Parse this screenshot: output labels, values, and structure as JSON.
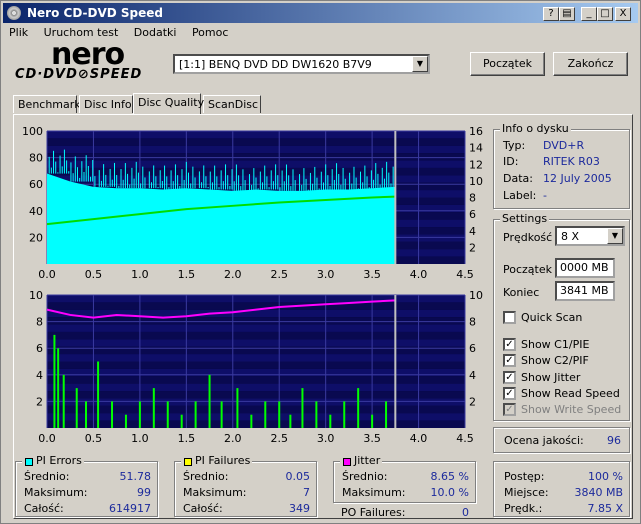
{
  "window": {
    "title": "Nero CD-DVD Speed",
    "help_label": "?",
    "minimize_label": "_",
    "maximize_label": "□",
    "close_label": "X"
  },
  "menu": [
    "Plik",
    "Uruchom test",
    "Dodatki",
    "Pomoc"
  ],
  "logo": {
    "brand": "nero",
    "product": "CD·DVD⊘SPEED"
  },
  "drive": {
    "selected": "[1:1]  BENQ DVD DD DW1620 B7V9"
  },
  "buttons": {
    "start": "Początek",
    "end": "Zakończ"
  },
  "tabs": [
    "Benchmark",
    "Disc Info",
    "Disc Quality",
    "ScanDisc"
  ],
  "active_tab": "Disc Quality",
  "disc_info": {
    "title": "Info o dysku",
    "rows": [
      {
        "label": "Typ:",
        "value": "DVD+R"
      },
      {
        "label": "ID:",
        "value": "RITEK R03"
      },
      {
        "label": "Data:",
        "value": "12 July 2005"
      },
      {
        "label": "Label:",
        "value": "-"
      }
    ]
  },
  "settings": {
    "title": "Settings",
    "speed_label": "Prędkość",
    "speed_value": "8 X",
    "start_label": "Początek",
    "start_value": "0000 MB",
    "end_label": "Koniec",
    "end_value": "3841 MB",
    "checks": [
      {
        "label": "Quick Scan",
        "checked": false,
        "enabled": true
      },
      {
        "label": "Show C1/PIE",
        "checked": true,
        "enabled": true
      },
      {
        "label": "Show C2/PIF",
        "checked": true,
        "enabled": true
      },
      {
        "label": "Show Jitter",
        "checked": true,
        "enabled": true
      },
      {
        "label": "Show Read Speed",
        "checked": true,
        "enabled": true
      },
      {
        "label": "Show Write Speed",
        "checked": true,
        "enabled": false
      }
    ]
  },
  "quality": {
    "label": "Ocena jakości:",
    "value": "96"
  },
  "pi_errors": {
    "title": "PI Errors",
    "color": "#00ffff",
    "rows": [
      {
        "label": "Średnio:",
        "value": "51.78"
      },
      {
        "label": "Maksimum:",
        "value": "99"
      },
      {
        "label": "Całość:",
        "value": "614917"
      }
    ]
  },
  "pi_failures": {
    "title": "PI Failures",
    "color": "#ffff00",
    "rows": [
      {
        "label": "Średnio:",
        "value": "0.05"
      },
      {
        "label": "Maksimum:",
        "value": "7"
      },
      {
        "label": "Całość:",
        "value": "349"
      }
    ]
  },
  "jitter": {
    "title": "Jitter",
    "color": "#ff00ff",
    "rows": [
      {
        "label": "Średnio:",
        "value": "8.65 %"
      },
      {
        "label": "Maksimum:",
        "value": "10.0 %"
      }
    ]
  },
  "po_failures": {
    "label": "PO Failures:",
    "value": "0"
  },
  "progress": {
    "rows": [
      {
        "label": "Postęp:",
        "value": "100 %"
      },
      {
        "label": "Miejsce:",
        "value": "3840 MB"
      },
      {
        "label": "Prędk.:",
        "value": "7.85 X"
      }
    ]
  },
  "chart_data": [
    {
      "type": "area",
      "panel": "PI errors / read speed",
      "x_ticks": [
        "0.0",
        "0.5",
        "1.0",
        "1.5",
        "2.0",
        "2.5",
        "3.0",
        "3.5",
        "4.0",
        "4.5"
      ],
      "y_left_ticks": [
        "100",
        "80",
        "60",
        "40",
        "20"
      ],
      "y_right_ticks": [
        "16",
        "14",
        "12",
        "10",
        "8",
        "6",
        "4",
        "2"
      ],
      "xlim": [
        0,
        4.5
      ],
      "ylim_left": [
        0,
        100
      ],
      "ylim_right": [
        0,
        16
      ],
      "scan_end_x": 3.75,
      "series": [
        {
          "color": "#00ffff",
          "values_x": [
            0,
            0.25,
            0.5,
            0.75,
            1.0,
            1.25,
            1.5,
            1.75,
            2.0,
            2.25,
            2.5,
            2.75,
            3.0,
            3.25,
            3.5,
            3.75
          ],
          "values_y": [
            68,
            62,
            58,
            57,
            57,
            56,
            57,
            56,
            55,
            56,
            55,
            55,
            56,
            56,
            57,
            58
          ]
        },
        {
          "color": "#00dd00",
          "axis": "right",
          "values_x": [
            0,
            0.5,
            1.0,
            1.5,
            2.0,
            2.5,
            3.0,
            3.5,
            3.75
          ],
          "values_y": [
            4.8,
            5.4,
            6.0,
            6.6,
            7.0,
            7.4,
            7.7,
            8.0,
            8.1
          ]
        }
      ]
    },
    {
      "type": "bar",
      "panel": "PI failures / jitter",
      "x_ticks": [
        "0.0",
        "0.5",
        "1.0",
        "1.5",
        "2.0",
        "2.5",
        "3.0",
        "3.5",
        "4.0",
        "4.5"
      ],
      "y_left_ticks": [
        "10",
        "8",
        "6",
        "4",
        "2"
      ],
      "y_right_ticks": [
        "10",
        "8",
        "6",
        "4",
        "2"
      ],
      "xlim": [
        0,
        4.5
      ],
      "ylim": [
        0,
        10
      ],
      "scan_end_x": 3.75,
      "failures": {
        "color": "#00ff00",
        "x": [
          0.08,
          0.12,
          0.18,
          0.32,
          0.42,
          0.55,
          0.7,
          0.85,
          1.0,
          1.15,
          1.3,
          1.45,
          1.6,
          1.75,
          1.88,
          2.05,
          2.2,
          2.35,
          2.5,
          2.62,
          2.75,
          2.9,
          3.05,
          3.2,
          3.35,
          3.5,
          3.65
        ],
        "y": [
          7,
          6,
          4,
          3,
          2,
          5,
          2,
          1,
          2,
          3,
          2,
          1,
          2,
          4,
          2,
          3,
          1,
          2,
          2,
          1,
          3,
          2,
          1,
          2,
          3,
          1,
          2
        ]
      },
      "jitter": {
        "color": "#ff00ff",
        "x": [
          0,
          0.25,
          0.5,
          0.75,
          1.0,
          1.25,
          1.5,
          1.75,
          2.0,
          2.25,
          2.5,
          2.75,
          3.0,
          3.25,
          3.5,
          3.75
        ],
        "y": [
          8.9,
          8.5,
          8.3,
          8.5,
          8.4,
          8.3,
          8.4,
          8.6,
          8.7,
          8.9,
          9.1,
          9.2,
          9.3,
          9.4,
          9.5,
          9.6
        ]
      }
    }
  ]
}
